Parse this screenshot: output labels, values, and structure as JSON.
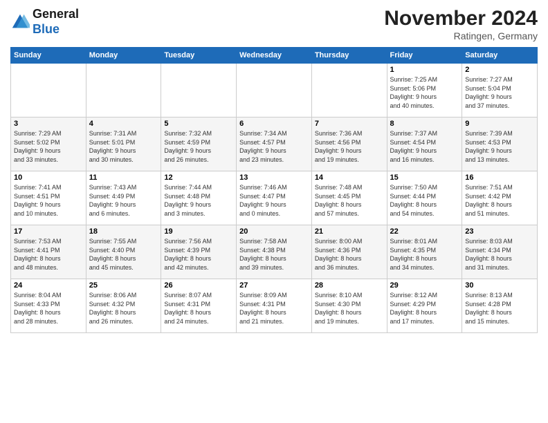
{
  "logo": {
    "general": "General",
    "blue": "Blue"
  },
  "title": "November 2024",
  "location": "Ratingen, Germany",
  "days_header": [
    "Sunday",
    "Monday",
    "Tuesday",
    "Wednesday",
    "Thursday",
    "Friday",
    "Saturday"
  ],
  "weeks": [
    [
      {
        "day": "",
        "info": ""
      },
      {
        "day": "",
        "info": ""
      },
      {
        "day": "",
        "info": ""
      },
      {
        "day": "",
        "info": ""
      },
      {
        "day": "",
        "info": ""
      },
      {
        "day": "1",
        "info": "Sunrise: 7:25 AM\nSunset: 5:06 PM\nDaylight: 9 hours\nand 40 minutes."
      },
      {
        "day": "2",
        "info": "Sunrise: 7:27 AM\nSunset: 5:04 PM\nDaylight: 9 hours\nand 37 minutes."
      }
    ],
    [
      {
        "day": "3",
        "info": "Sunrise: 7:29 AM\nSunset: 5:02 PM\nDaylight: 9 hours\nand 33 minutes."
      },
      {
        "day": "4",
        "info": "Sunrise: 7:31 AM\nSunset: 5:01 PM\nDaylight: 9 hours\nand 30 minutes."
      },
      {
        "day": "5",
        "info": "Sunrise: 7:32 AM\nSunset: 4:59 PM\nDaylight: 9 hours\nand 26 minutes."
      },
      {
        "day": "6",
        "info": "Sunrise: 7:34 AM\nSunset: 4:57 PM\nDaylight: 9 hours\nand 23 minutes."
      },
      {
        "day": "7",
        "info": "Sunrise: 7:36 AM\nSunset: 4:56 PM\nDaylight: 9 hours\nand 19 minutes."
      },
      {
        "day": "8",
        "info": "Sunrise: 7:37 AM\nSunset: 4:54 PM\nDaylight: 9 hours\nand 16 minutes."
      },
      {
        "day": "9",
        "info": "Sunrise: 7:39 AM\nSunset: 4:53 PM\nDaylight: 9 hours\nand 13 minutes."
      }
    ],
    [
      {
        "day": "10",
        "info": "Sunrise: 7:41 AM\nSunset: 4:51 PM\nDaylight: 9 hours\nand 10 minutes."
      },
      {
        "day": "11",
        "info": "Sunrise: 7:43 AM\nSunset: 4:49 PM\nDaylight: 9 hours\nand 6 minutes."
      },
      {
        "day": "12",
        "info": "Sunrise: 7:44 AM\nSunset: 4:48 PM\nDaylight: 9 hours\nand 3 minutes."
      },
      {
        "day": "13",
        "info": "Sunrise: 7:46 AM\nSunset: 4:47 PM\nDaylight: 9 hours\nand 0 minutes."
      },
      {
        "day": "14",
        "info": "Sunrise: 7:48 AM\nSunset: 4:45 PM\nDaylight: 8 hours\nand 57 minutes."
      },
      {
        "day": "15",
        "info": "Sunrise: 7:50 AM\nSunset: 4:44 PM\nDaylight: 8 hours\nand 54 minutes."
      },
      {
        "day": "16",
        "info": "Sunrise: 7:51 AM\nSunset: 4:42 PM\nDaylight: 8 hours\nand 51 minutes."
      }
    ],
    [
      {
        "day": "17",
        "info": "Sunrise: 7:53 AM\nSunset: 4:41 PM\nDaylight: 8 hours\nand 48 minutes."
      },
      {
        "day": "18",
        "info": "Sunrise: 7:55 AM\nSunset: 4:40 PM\nDaylight: 8 hours\nand 45 minutes."
      },
      {
        "day": "19",
        "info": "Sunrise: 7:56 AM\nSunset: 4:39 PM\nDaylight: 8 hours\nand 42 minutes."
      },
      {
        "day": "20",
        "info": "Sunrise: 7:58 AM\nSunset: 4:38 PM\nDaylight: 8 hours\nand 39 minutes."
      },
      {
        "day": "21",
        "info": "Sunrise: 8:00 AM\nSunset: 4:36 PM\nDaylight: 8 hours\nand 36 minutes."
      },
      {
        "day": "22",
        "info": "Sunrise: 8:01 AM\nSunset: 4:35 PM\nDaylight: 8 hours\nand 34 minutes."
      },
      {
        "day": "23",
        "info": "Sunrise: 8:03 AM\nSunset: 4:34 PM\nDaylight: 8 hours\nand 31 minutes."
      }
    ],
    [
      {
        "day": "24",
        "info": "Sunrise: 8:04 AM\nSunset: 4:33 PM\nDaylight: 8 hours\nand 28 minutes."
      },
      {
        "day": "25",
        "info": "Sunrise: 8:06 AM\nSunset: 4:32 PM\nDaylight: 8 hours\nand 26 minutes."
      },
      {
        "day": "26",
        "info": "Sunrise: 8:07 AM\nSunset: 4:31 PM\nDaylight: 8 hours\nand 24 minutes."
      },
      {
        "day": "27",
        "info": "Sunrise: 8:09 AM\nSunset: 4:31 PM\nDaylight: 8 hours\nand 21 minutes."
      },
      {
        "day": "28",
        "info": "Sunrise: 8:10 AM\nSunset: 4:30 PM\nDaylight: 8 hours\nand 19 minutes."
      },
      {
        "day": "29",
        "info": "Sunrise: 8:12 AM\nSunset: 4:29 PM\nDaylight: 8 hours\nand 17 minutes."
      },
      {
        "day": "30",
        "info": "Sunrise: 8:13 AM\nSunset: 4:28 PM\nDaylight: 8 hours\nand 15 minutes."
      }
    ]
  ]
}
